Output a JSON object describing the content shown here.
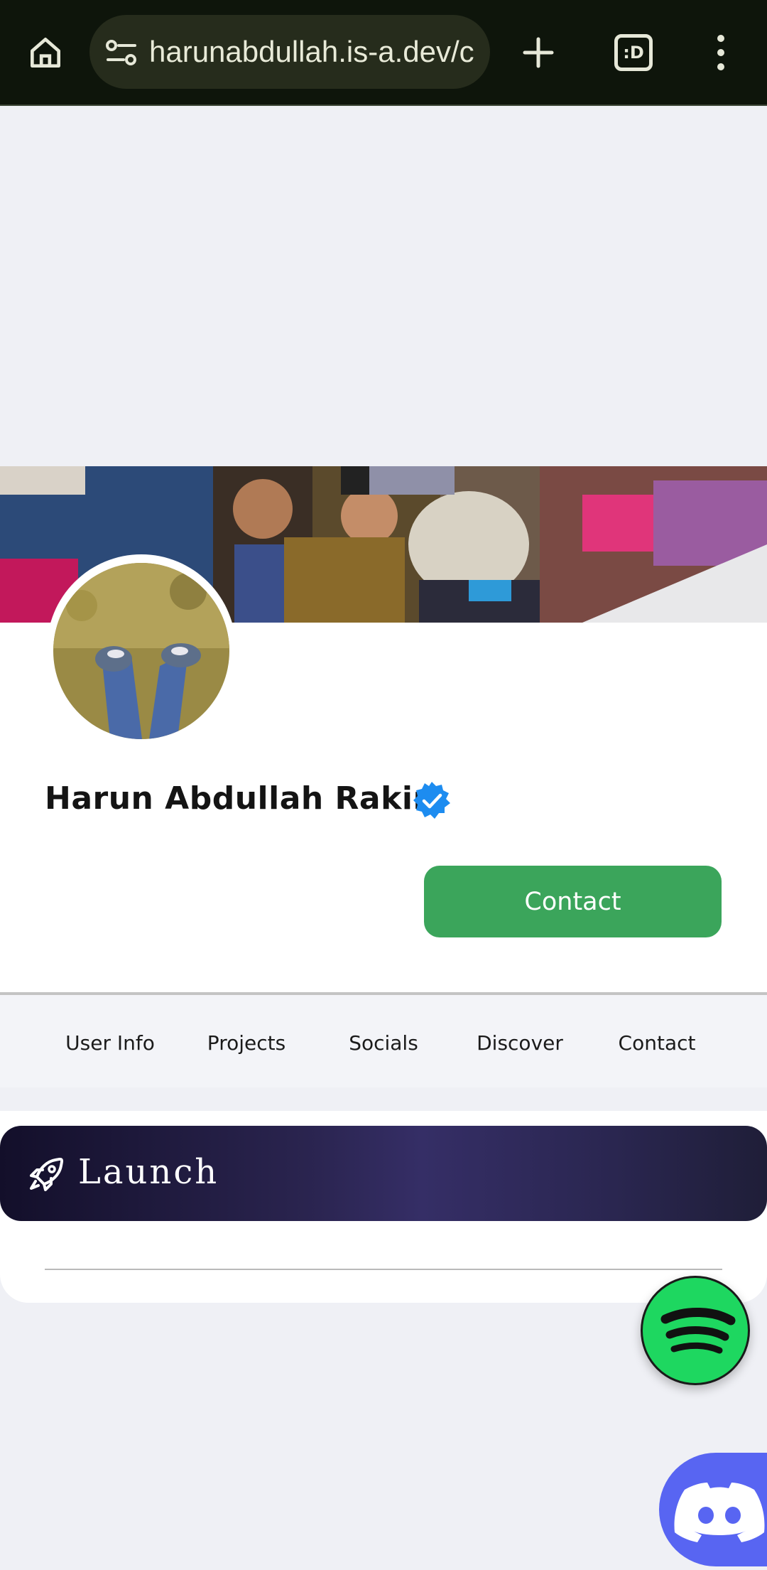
{
  "browser": {
    "url": "harunabdullah.is-a.dev/c",
    "tab_count": ":D"
  },
  "profile": {
    "name": "Harun Abdullah Rakin",
    "contact_label": "Contact"
  },
  "nav_tabs": [
    "User Info",
    "Projects",
    "Socials",
    "Discover",
    "Contact"
  ],
  "section": {
    "title": "Launch"
  },
  "icons": {
    "home": "home-icon",
    "site_info": "site-settings-icon",
    "new_tab": "plus-icon",
    "menu": "more-vertical-icon",
    "verified": "verified-badge-icon",
    "launch": "rocket-icon",
    "spotify": "spotify-icon",
    "discord": "discord-icon"
  },
  "colors": {
    "contact_button": "#3ba55b",
    "verified_badge": "#1d8cf0",
    "spotify": "#1ed760",
    "discord": "#5865f2"
  }
}
